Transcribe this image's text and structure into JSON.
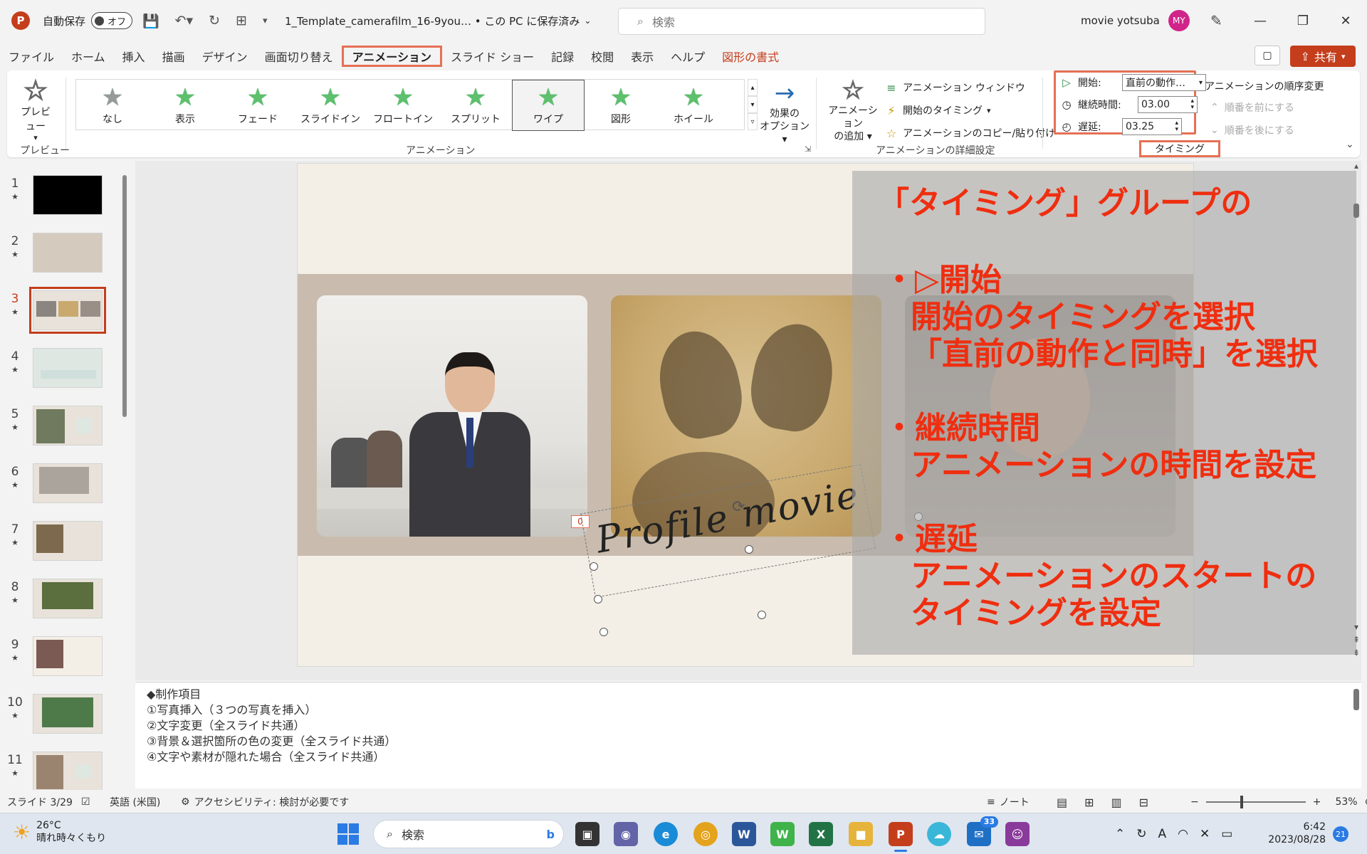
{
  "titlebar": {
    "autosave_label": "自動保存",
    "autosave_state": "オフ",
    "doc_title": "1_Template_camerafilm_16-9you… • この PC に保存済み",
    "search_placeholder": "検索",
    "user_name": "movie yotsuba",
    "user_initials": "MY"
  },
  "menu": {
    "items": [
      "ファイル",
      "ホーム",
      "挿入",
      "描画",
      "デザイン",
      "画面切り替え",
      "アニメーション",
      "スライド ショー",
      "記録",
      "校閲",
      "表示",
      "ヘルプ",
      "図形の書式"
    ],
    "active": "アニメーション",
    "share_label": "共有"
  },
  "ribbon": {
    "preview_label": "プレビュー",
    "preview_group": "プレビュー",
    "animation_group": "アニメーション",
    "gallery": [
      "なし",
      "表示",
      "フェード",
      "スライドイン",
      "フロートイン",
      "スプリット",
      "ワイプ",
      "図形",
      "ホイール"
    ],
    "gallery_selected": "ワイプ",
    "effect_options": [
      "効果の",
      "オプション"
    ],
    "add_animation": [
      "アニメーション",
      "の追加"
    ],
    "advanced": {
      "group": "アニメーションの詳細設定",
      "items": [
        "アニメーション ウィンドウ",
        "開始のタイミング",
        "アニメーションのコピー/貼り付け"
      ]
    },
    "timing": {
      "group": "タイミング",
      "start_label": "開始:",
      "start_value": "直前の動作…",
      "duration_label": "継続時間:",
      "duration_value": "03.00",
      "delay_label": "遅延:",
      "delay_value": "03.25"
    },
    "reorder": {
      "title": "アニメーションの順序変更",
      "earlier": "順番を前にする",
      "later": "順番を後にする"
    }
  },
  "thumbnails": [
    {
      "num": "1"
    },
    {
      "num": "2"
    },
    {
      "num": "3",
      "active": true
    },
    {
      "num": "4"
    },
    {
      "num": "5"
    },
    {
      "num": "6"
    },
    {
      "num": "7"
    },
    {
      "num": "8"
    },
    {
      "num": "9"
    },
    {
      "num": "10"
    },
    {
      "num": "11"
    }
  ],
  "thumb_star": "★",
  "slide": {
    "badge": "0",
    "script_text": "Profile movie"
  },
  "overlay": {
    "line1": "「タイミング」グループの",
    "line2": "・▷開始",
    "line3": "開始のタイミングを選択",
    "line4": "「直前の動作と同時」を選択",
    "line5": "・継続時間",
    "line6": "アニメーションの時間を設定",
    "line7": "・遅延",
    "line8": "アニメーションのスタートの",
    "line9": "タイミングを設定"
  },
  "notes": [
    "◆制作項目",
    "①写真挿入（３つの写真を挿入）",
    "②文字変更（全スライド共通）",
    "③背景＆選択箇所の色の変更（全スライド共通）",
    "④文字や素材が隠れた場合（全スライド共通）"
  ],
  "status": {
    "slide_pos": "スライド 3/29",
    "language": "英語 (米国)",
    "accessibility": "アクセシビリティ: 検討が必要です",
    "notes_label": "ノート",
    "zoom": "53%"
  },
  "taskbar": {
    "temp": "26°C",
    "weather": "晴れ時々くもり",
    "search": "検索",
    "mail_badge": "33",
    "time": "6:42",
    "date": "2023/08/28",
    "notif_count": "21"
  },
  "colors": {
    "accent": "#c43e1c",
    "highlight_box": "#e57054",
    "overlay_text": "#ef2e10"
  }
}
